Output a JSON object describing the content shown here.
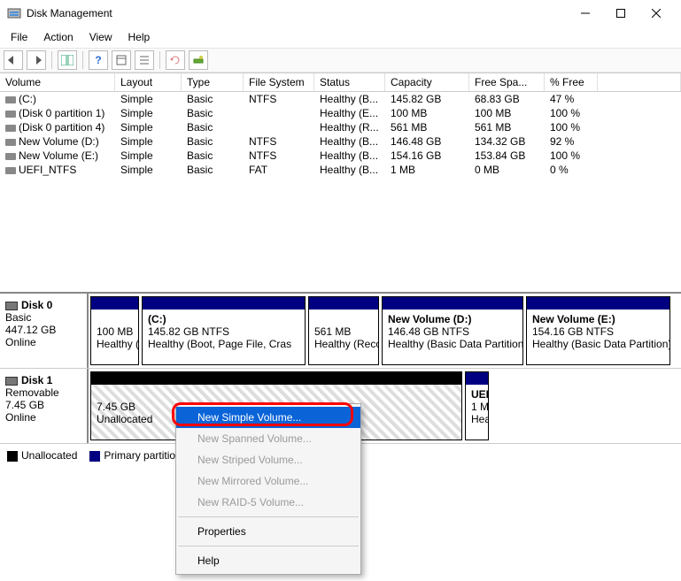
{
  "window": {
    "title": "Disk Management"
  },
  "menu": {
    "file": "File",
    "action": "Action",
    "view": "View",
    "help": "Help"
  },
  "columns": {
    "volume": "Volume",
    "layout": "Layout",
    "type": "Type",
    "fs": "File System",
    "status": "Status",
    "cap": "Capacity",
    "free": "Free Spa...",
    "pct": "% Free"
  },
  "rows": [
    {
      "vol": "(C:)",
      "layout": "Simple",
      "type": "Basic",
      "fs": "NTFS",
      "status": "Healthy (B...",
      "cap": "145.82 GB",
      "free": "68.83 GB",
      "pct": "47 %"
    },
    {
      "vol": "(Disk 0 partition 1)",
      "layout": "Simple",
      "type": "Basic",
      "fs": "",
      "status": "Healthy (E...",
      "cap": "100 MB",
      "free": "100 MB",
      "pct": "100 %"
    },
    {
      "vol": "(Disk 0 partition 4)",
      "layout": "Simple",
      "type": "Basic",
      "fs": "",
      "status": "Healthy (R...",
      "cap": "561 MB",
      "free": "561 MB",
      "pct": "100 %"
    },
    {
      "vol": "New Volume (D:)",
      "layout": "Simple",
      "type": "Basic",
      "fs": "NTFS",
      "status": "Healthy (B...",
      "cap": "146.48 GB",
      "free": "134.32 GB",
      "pct": "92 %"
    },
    {
      "vol": "New Volume (E:)",
      "layout": "Simple",
      "type": "Basic",
      "fs": "NTFS",
      "status": "Healthy (B...",
      "cap": "154.16 GB",
      "free": "153.84 GB",
      "pct": "100 %"
    },
    {
      "vol": "UEFI_NTFS",
      "layout": "Simple",
      "type": "Basic",
      "fs": "FAT",
      "status": "Healthy (B...",
      "cap": "1 MB",
      "free": "0 MB",
      "pct": "0 %"
    }
  ],
  "disk0": {
    "name": "Disk 0",
    "sub1": "Basic",
    "sub2": "447.12 GB",
    "sub3": "Online",
    "p0l1": "100 MB",
    "p0l2": "Healthy (",
    "p1l1": "(C:)",
    "p1l2": "145.82 GB NTFS",
    "p1l3": "Healthy (Boot, Page File, Cras",
    "p2l1": "561 MB",
    "p2l2": "Healthy (Reco",
    "p3l1": "New Volume  (D:)",
    "p3l2": "146.48 GB NTFS",
    "p3l3": "Healthy (Basic Data Partition)",
    "p4l1": "New Volume  (E:)",
    "p4l2": "154.16 GB NTFS",
    "p4l3": "Healthy (Basic Data Partition)"
  },
  "disk1": {
    "name": "Disk 1",
    "sub1": "Removable",
    "sub2": "7.45 GB",
    "sub3": "Online",
    "p0l1": "7.45 GB",
    "p0l2": "Unallocated",
    "p1l1": "UEF",
    "p1l2": "1 M",
    "p1l3": "Hea"
  },
  "legend": {
    "unalloc": "Unallocated",
    "primary": "Primary partition"
  },
  "ctx": {
    "newSimple": "New Simple Volume...",
    "newSpanned": "New Spanned Volume...",
    "newStriped": "New Striped Volume...",
    "newMirrored": "New Mirrored Volume...",
    "newRaid5": "New RAID-5 Volume...",
    "props": "Properties",
    "help": "Help"
  }
}
